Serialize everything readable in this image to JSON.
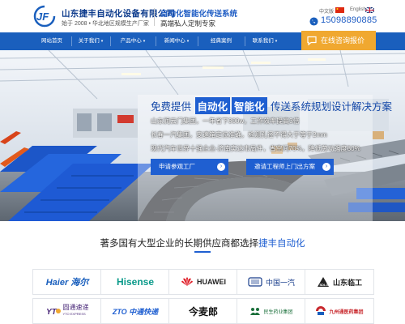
{
  "header": {
    "logo_text": "JF",
    "company_name": "山东捷丰自动化设备有限公司",
    "company_sub": "始于 2008 • 华北地区规模生产厂家",
    "slogan_main": "自动化智能化传送系统",
    "slogan_sub": "高端私人定制专家",
    "lang_cn": "中文版",
    "lang_en": "English",
    "phone": "15098890885"
  },
  "nav": {
    "items": [
      {
        "label": "网站首页",
        "has_caret": false
      },
      {
        "label": "关于我们",
        "has_caret": true
      },
      {
        "label": "产品中心",
        "has_caret": true
      },
      {
        "label": "新闻中心",
        "has_caret": true
      },
      {
        "label": "经典案例",
        "has_caret": false
      },
      {
        "label": "联系我们",
        "has_caret": true
      }
    ],
    "consult_label": "在线咨询报价"
  },
  "banner": {
    "title_pre": "免费提供",
    "title_hl1": "自动化",
    "title_hl2": "智能化",
    "title_post": "传送系统规划设计解决方案",
    "lines": [
      "山东润云门集团，一年省下300w，工作效率提高3倍",
      "长春一汽集团，变速箱定位准确，检测孔径不得大于等于2mm",
      "现代汽车世界十强企业-济南实达市局件，省空间70%，降低劳动强度80%"
    ],
    "btn_visit": "申请参观工厂",
    "btn_engineer": "邀请工程师上门出方案"
  },
  "partners": {
    "title_pre": "著多国有大型企业的长期供应商都选择",
    "title_accent": "捷丰自动化",
    "brands": [
      {
        "name": "Haier 海尔",
        "color": "#1a5fbd"
      },
      {
        "name": "Hisense",
        "color": "#0a9a8a"
      },
      {
        "name": "HUAWEI",
        "color": "#222222"
      },
      {
        "name": "中国一汽",
        "color": "#1a3f8c"
      },
      {
        "name": "山东临工",
        "color": "#222222"
      },
      {
        "name": "圆通速递",
        "sub": "YTO EXPRESS",
        "color": "#4b2a7a"
      },
      {
        "name": "ZTO 中通快递",
        "color": "#1f5fd1"
      },
      {
        "name": "今麦郎",
        "color": "#111111"
      },
      {
        "name": "民生药业集团",
        "color": "#1a6f3a"
      },
      {
        "name": "九州通医药集团",
        "color": "#c8282d"
      }
    ]
  },
  "colors": {
    "brand_blue": "#1a5fbd",
    "accent_orange": "#f0a830"
  }
}
